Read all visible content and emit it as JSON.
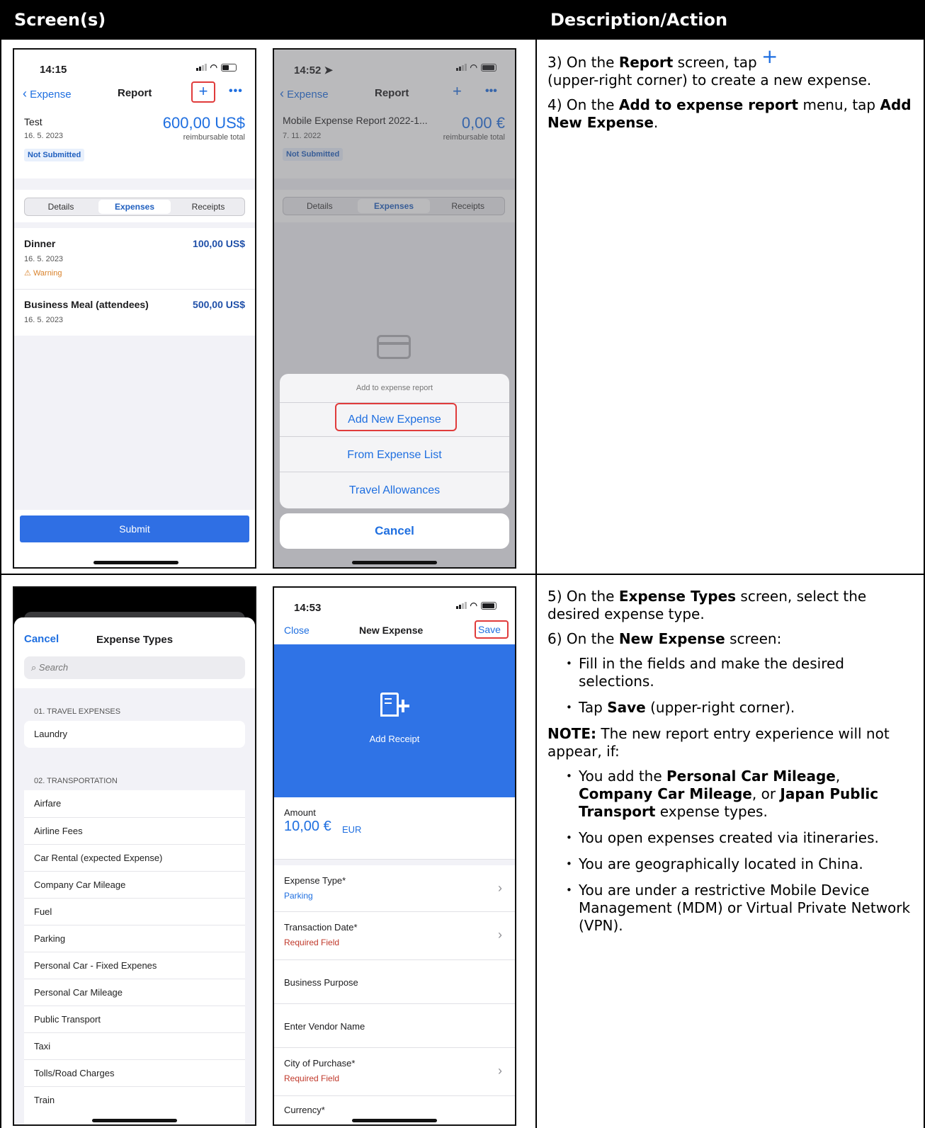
{
  "table": {
    "col1_header": "Screen(s)",
    "col2_header": "Description/Action"
  },
  "phone1": {
    "time": "14:15",
    "back": "Expense",
    "title": "Report",
    "report_name": "Test",
    "report_date": "16. 5. 2023",
    "total": "600,00 US$",
    "total_label": "reimbursable total",
    "status": "Not Submitted",
    "tabs": [
      "Details",
      "Expenses",
      "Receipts"
    ],
    "expenses": [
      {
        "name": "Dinner",
        "date": "16. 5. 2023",
        "amount": "100,00 US$",
        "warning": "Warning"
      },
      {
        "name": "Business Meal (attendees)",
        "date": "16. 5. 2023",
        "amount": "500,00 US$"
      }
    ],
    "submit": "Submit"
  },
  "phone2": {
    "time": "14:52",
    "back": "Expense",
    "title": "Report",
    "report_name": "Mobile Expense Report 2022-1...",
    "report_date": "7. 11. 2022",
    "total": "0,00 €",
    "total_label": "reimbursable total",
    "status": "Not Submitted",
    "tabs": [
      "Details",
      "Expenses",
      "Receipts"
    ],
    "sheet_title": "Add to expense report",
    "sheet_items": [
      "Add New Expense",
      "From Expense List",
      "Travel Allowances"
    ],
    "cancel": "Cancel"
  },
  "phone3": {
    "cancel": "Cancel",
    "title": "Expense Types",
    "search_placeholder": "Search",
    "sections": [
      {
        "header": "01. TRAVEL EXPENSES",
        "items": [
          "Laundry"
        ]
      },
      {
        "header": "02. TRANSPORTATION",
        "items": [
          "Airfare",
          "Airline Fees",
          "Car Rental (expected Expense)",
          "Company Car Mileage",
          "Fuel",
          "Parking",
          "Personal Car - Fixed Expenes",
          "Personal Car Mileage",
          "Public Transport",
          "Taxi",
          "Tolls/Road Charges",
          "Train"
        ]
      }
    ]
  },
  "phone4": {
    "time": "14:53",
    "close": "Close",
    "title": "New Expense",
    "save": "Save",
    "add_receipt": "Add Receipt",
    "amount_label": "Amount",
    "amount_value": "10,00 €",
    "amount_currency": "EUR",
    "fields": [
      {
        "label": "Expense Type*",
        "value": "Parking"
      },
      {
        "label": "Transaction Date*",
        "value": "Required Field"
      },
      {
        "label": "Business Purpose",
        "value": ""
      },
      {
        "label": "Enter Vendor Name",
        "value": ""
      },
      {
        "label": "City of Purchase*",
        "value": "Required Field"
      },
      {
        "label": "Currency*",
        "value": ""
      }
    ]
  },
  "desc1": {
    "s3_pre": "3) On the ",
    "s3_b1": "Report",
    "s3_mid": " screen, tap ",
    "s3_post": "(upper-right corner) to create a new expense.",
    "s4_pre": "4) On the ",
    "s4_b1": "Add to expense report",
    "s4_mid": " menu, tap ",
    "s4_b2": "Add New Expense",
    "s4_end": "."
  },
  "desc2": {
    "s5_pre": "5) On the ",
    "s5_b1": "Expense Types",
    "s5_post": " screen, select the desired expense type.",
    "s6_pre": "6) On the ",
    "s6_b1": "New Expense",
    "s6_post": " screen:",
    "b1": "Fill in the fields and make the desired selections.",
    "b2_pre": "Tap ",
    "b2_b": "Save",
    "b2_post": " (upper-right corner).",
    "note_b": "NOTE:",
    "note_post": " The new report entry experience will not appear, if:",
    "n1_pre": "You add the ",
    "n1_b1": "Personal Car Mileage",
    "n1_c1": ", ",
    "n1_b2": "Company Car Mileage",
    "n1_c2": ", or ",
    "n1_b3": "Japan Public Transport",
    "n1_post": " expense types.",
    "n2": "You open expenses created via itineraries.",
    "n3": "You are geographically located in China.",
    "n4": "You are under a restrictive Mobile Device Management (MDM) or Virtual Private Network (VPN)."
  }
}
